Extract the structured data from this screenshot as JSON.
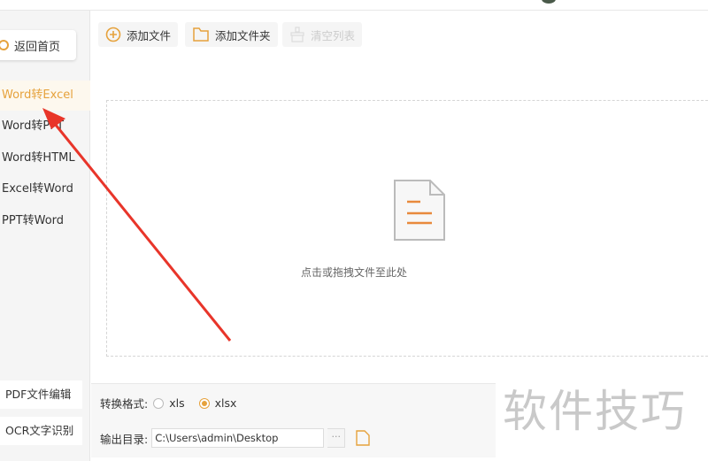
{
  "sidebar": {
    "back_label": "返回首页",
    "items": [
      {
        "label": "Word转Excel"
      },
      {
        "label": "Word转PPT"
      },
      {
        "label": "Word转HTML"
      },
      {
        "label": "Excel转Word"
      },
      {
        "label": "PPT转Word"
      }
    ],
    "pdf_edit": "PDF文件编辑",
    "ocr": "OCR文字识别"
  },
  "toolbar": {
    "add_file": "添加文件",
    "add_folder": "添加文件夹",
    "clear": "清空列表"
  },
  "drop": {
    "hint": "点击或拖拽文件至此处"
  },
  "settings": {
    "format_label": "转换格式:",
    "options": [
      "xls",
      "xlsx"
    ],
    "selected": "xlsx",
    "output_label": "输出目录:",
    "output_path": "C:\\Users\\admin\\Desktop",
    "browse": "···"
  },
  "watermark": "软件技巧",
  "colors": {
    "accent": "#e6a23c",
    "arrow": "#e8352a"
  }
}
